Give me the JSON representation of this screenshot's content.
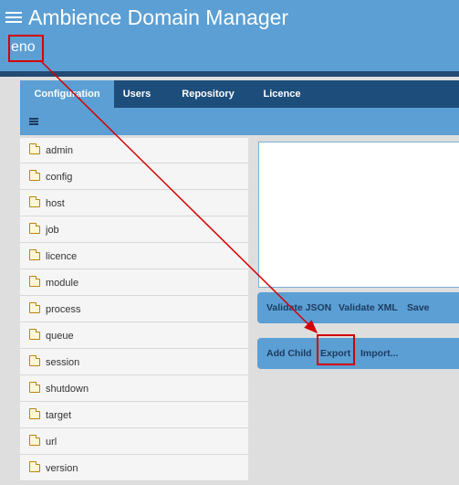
{
  "app": {
    "title": "Ambience Domain Manager",
    "user": "eno"
  },
  "tabs": [
    {
      "label": "Configuration",
      "active": true
    },
    {
      "label": "Users",
      "active": false
    },
    {
      "label": "Repository",
      "active": false
    },
    {
      "label": "Licence",
      "active": false
    }
  ],
  "tree": {
    "items": [
      {
        "label": "admin"
      },
      {
        "label": "config"
      },
      {
        "label": "host"
      },
      {
        "label": "job"
      },
      {
        "label": "licence"
      },
      {
        "label": "module"
      },
      {
        "label": "process"
      },
      {
        "label": "queue"
      },
      {
        "label": "session"
      },
      {
        "label": "shutdown"
      },
      {
        "label": "target"
      },
      {
        "label": "url"
      },
      {
        "label": "version"
      }
    ]
  },
  "editor": {
    "value": ""
  },
  "validate_bar": {
    "validate_json": "Validate JSON",
    "validate_xml": "Validate XML",
    "save": "Save"
  },
  "node_bar": {
    "add_child": "Add Child",
    "export": "Export",
    "import": "Import..."
  },
  "colors": {
    "header_blue": "#5b9fd4",
    "tab_dark": "#1d4d7a",
    "annotation_red": "#d40000"
  },
  "icons": {
    "menu": "hamburger-menu-icon",
    "sub_menu": "menu-icon",
    "folder": "folder-icon"
  }
}
